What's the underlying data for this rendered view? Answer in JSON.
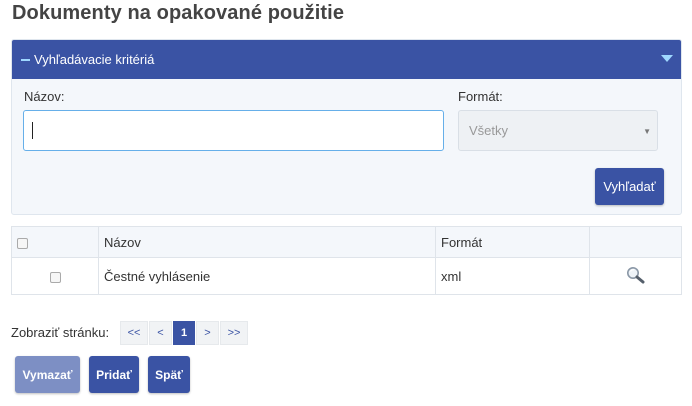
{
  "page": {
    "title": "Dokumenty na opakované použitie"
  },
  "search_panel": {
    "title": "Vyhľadávacie kritériá",
    "name_label": "Názov:",
    "name_value": "",
    "format_label": "Formát:",
    "format_selected": "Všetky",
    "search_button": "Vyhľadať"
  },
  "table": {
    "columns": [
      "",
      "Názov",
      "Formát",
      ""
    ],
    "rows": [
      {
        "name": "Čestné vyhlásenie",
        "format": "xml"
      }
    ]
  },
  "pager": {
    "label": "Zobraziť stránku:",
    "first": "<<",
    "prev": "<",
    "current": "1",
    "next": ">",
    "last": ">>"
  },
  "actions": {
    "delete": "Vymazať",
    "add": "Pridať",
    "back": "Späť"
  },
  "colors": {
    "primary": "#3a53a4",
    "disabled_button": "#7d8fc4",
    "panel_background": "#f4f7fb",
    "accent_icon": "#9fd8ff"
  },
  "icons": {
    "collapse": "minus-icon",
    "panel_toggle": "chevron-down-icon",
    "detail": "magnifier-icon"
  }
}
